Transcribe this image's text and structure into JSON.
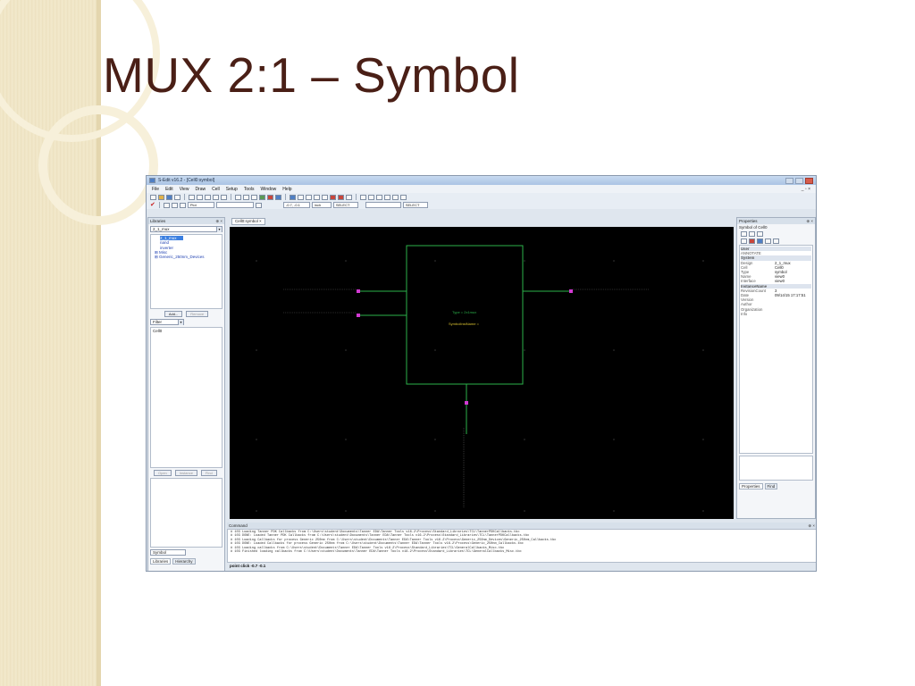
{
  "slide": {
    "title": "MUX 2:1 – Symbol"
  },
  "app": {
    "window_title": "S-Edit v16.2 - [Cell0:symbol]",
    "menu": [
      "File",
      "Edit",
      "View",
      "Draw",
      "Cell",
      "Setup",
      "Tools",
      "Window",
      "Help"
    ],
    "toolbar": {
      "layer_value": "Plot",
      "coord_value": "-0.7, -0.1",
      "units_value": "inch",
      "mode_1": "SELECT",
      "mode_2": "SELECT"
    },
    "libraries_panel": {
      "title": "Libraries",
      "selected_library": "2_1_mux",
      "tree": [
        "2_1_mux",
        "nand",
        "inverter",
        "Misc",
        "Generic_250nm_Devices"
      ],
      "add_button": "Add...",
      "remove_button": "Remove",
      "filter_label": "Filter",
      "cells": [
        "Cell0"
      ],
      "open_button": "Open",
      "instance_button": "Instance",
      "find_button": "Find",
      "view_field": "Symbol",
      "tab_libraries": "Libraries",
      "tab_hierarchy": "Hierarchy"
    },
    "document_tab": "Cell0:symbol",
    "canvas": {
      "instance_type_label": "Type = 2x1mux",
      "instance_name_label": "SymbolInstName ="
    },
    "properties_panel": {
      "title": "Properties",
      "subtitle": "Symbol of Cell0",
      "rows": [
        {
          "k": "User",
          "v": "",
          "section": true
        },
        {
          "k": "ANNOTATE",
          "v": "",
          "section": false
        },
        {
          "k": "System",
          "v": "",
          "section": true
        },
        {
          "k": "Design",
          "v": "2_1_mux",
          "section": false
        },
        {
          "k": "Cell",
          "v": "Cell0",
          "section": false
        },
        {
          "k": "Type",
          "v": "symbol",
          "section": false
        },
        {
          "k": "Name",
          "v": "view0",
          "section": false
        },
        {
          "k": "Interface",
          "v": "view0",
          "section": false
        },
        {
          "k": "InstanceName",
          "v": "",
          "section": true
        },
        {
          "k": "RevisionCount",
          "v": "3",
          "section": false
        },
        {
          "k": "Date",
          "v": "09/14/15 17:17:51",
          "section": false
        },
        {
          "k": "Version",
          "v": "",
          "section": false
        },
        {
          "k": "Author",
          "v": "",
          "section": false
        },
        {
          "k": "Organization",
          "v": "",
          "section": false
        },
        {
          "k": "Info",
          "v": "",
          "section": false
        }
      ],
      "tab_properties": "Properties",
      "tab_find": "Find"
    },
    "command": {
      "title": "Command",
      "lines": [
        "# 103  Loading Tanner PDK Callbacks from C:\\Users\\student\\Documents\\Tanner EDA\\Tanner Tools v16.2\\Process\\Standard_Libraries\\TCL\\TannerPDKCallbacks.tbc",
        "# 103    DONE: Loaded Tanner PDK Callbacks from C:\\Users\\student\\Documents\\Tanner EDA\\Tanner Tools v16.2\\Process\\Standard_Libraries\\TCL\\TannerPDKCallbacks.tbc",
        "# 103  Loading Callbacks for process Generic 250nm from C:\\Users\\student\\Documents\\Tanner EDA\\Tanner Tools v16.2\\Process\\Generic_250nm_Devices\\Generic_250nm_Callbacks.tbc",
        "# 103    DONE: Loaded Callbacks for process Generic 250nm from C:\\Users\\student\\Documents\\Tanner EDA\\Tanner Tools v16.2\\Process\\Generic_250nm_Callbacks.tbc",
        "# 103  Loading callbacks from C:\\Users\\student\\Documents\\Tanner EDA\\Tanner Tools v16.2\\Process\\Standard_Libraries\\TCL\\GeneralCallbacks_Misc.tbc",
        "# 103    Finished loading callbacks from C:\\Users\\student\\Documents\\Tanner EDA\\Tanner Tools v16.2\\Process\\Standard_Libraries\\TCL\\GeneralCallbacks_Misc.tbc"
      ],
      "input": "point click -0.7 -0.1"
    },
    "colors": {
      "canvas_bg": "#000000",
      "wire_green": "#2bb24a",
      "pin_magenta": "#d23ad2",
      "text_grey": "#9a9a9a"
    }
  }
}
